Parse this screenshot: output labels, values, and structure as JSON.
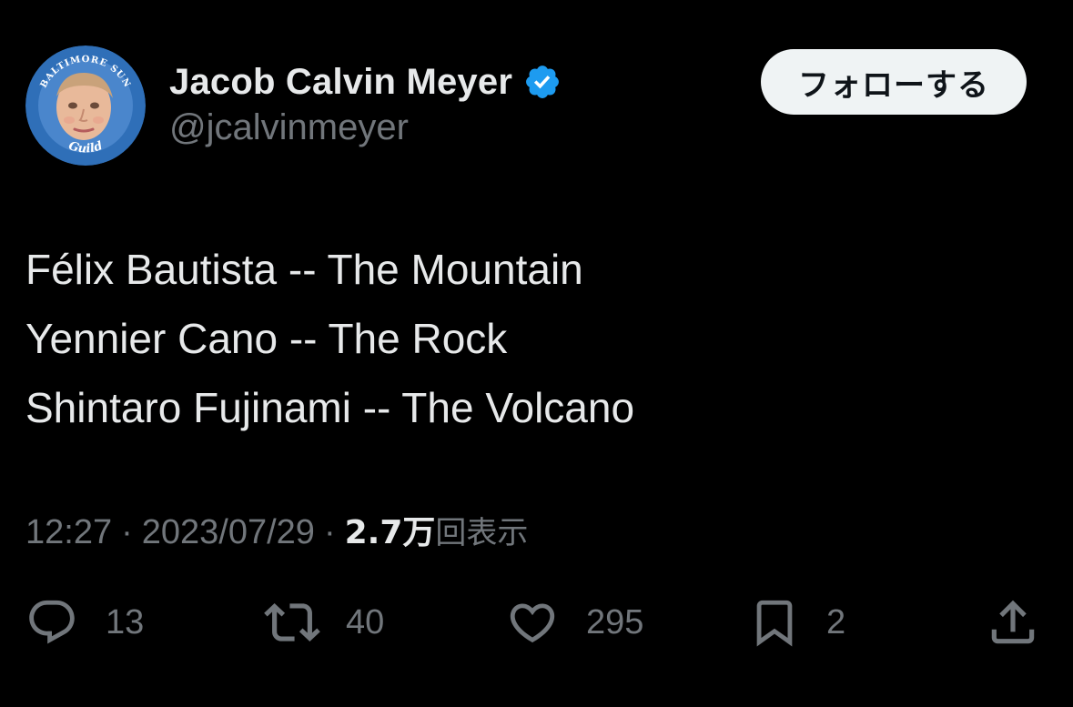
{
  "author": {
    "display_name": "Jacob Calvin Meyer",
    "handle": "@jcalvinmeyer",
    "verified": true,
    "verified_color": "#1d9bf0",
    "avatar_badge_top": "BALTIMORE SUN",
    "avatar_badge_bottom": "Guild"
  },
  "follow_button": {
    "label": "フォローする"
  },
  "tweet": {
    "lines": [
      "Félix Bautista -- The Mountain",
      "Yennier Cano -- The Rock",
      "Shintaro Fujinami -- The Volcano"
    ]
  },
  "meta": {
    "time": "12:27",
    "separator": "·",
    "date": "2023/07/29",
    "views_count": "2.7万",
    "views_label": "回表示"
  },
  "actions": {
    "reply": {
      "icon": "reply-icon",
      "count": "13"
    },
    "repost": {
      "icon": "repost-icon",
      "count": "40"
    },
    "like": {
      "icon": "heart-icon",
      "count": "295"
    },
    "bookmark": {
      "icon": "bookmark-icon",
      "count": "2"
    },
    "share": {
      "icon": "share-icon"
    }
  },
  "colors": {
    "background": "#000000",
    "text_primary": "#e7e9ea",
    "text_secondary": "#71767b",
    "button_bg": "#eff3f4"
  }
}
